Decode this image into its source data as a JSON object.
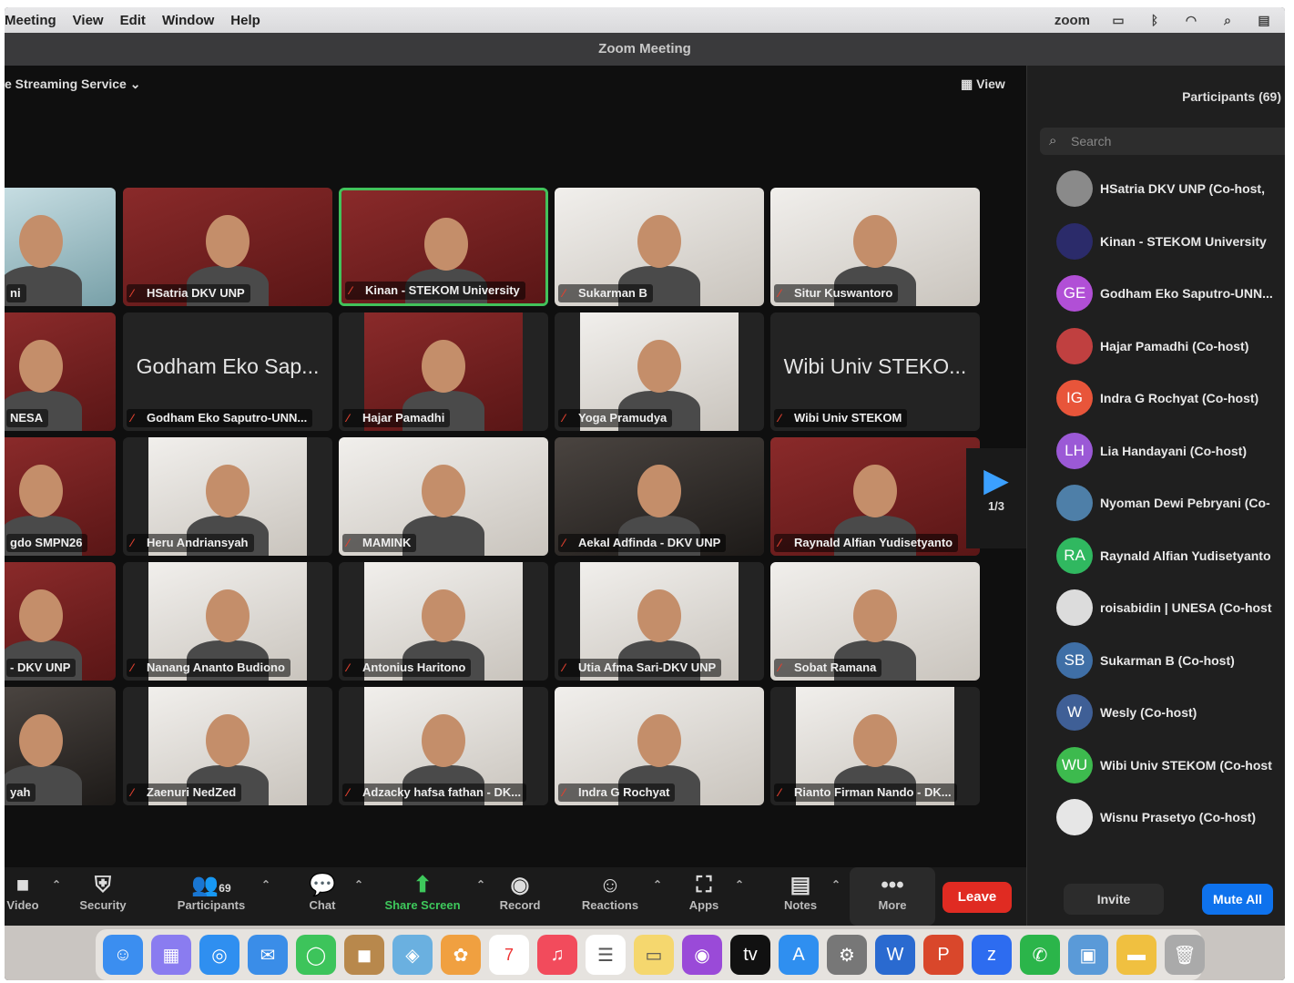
{
  "menubar": {
    "items": [
      "Meeting",
      "View",
      "Edit",
      "Window",
      "Help"
    ],
    "app_label": "zoom"
  },
  "window": {
    "title": "Zoom Meeting",
    "stream_label": "e Streaming Service",
    "view_label": "View"
  },
  "tiles": [
    {
      "name": "ni",
      "big": ""
    },
    {
      "name": "HSatria DKV UNP",
      "big": ""
    },
    {
      "name": "Kinan - STEKOM University",
      "big": "",
      "speaking": true
    },
    {
      "name": "Sukarman B",
      "big": ""
    },
    {
      "name": "Situr Kuswantoro",
      "big": ""
    },
    {
      "name": "NESA",
      "big": ""
    },
    {
      "name": "Godham Eko Saputro-UNN...",
      "big": "Godham Eko Sap..."
    },
    {
      "name": "Hajar Pamadhi",
      "big": ""
    },
    {
      "name": "Yoga Pramudya",
      "big": ""
    },
    {
      "name": "Wibi Univ STEKOM",
      "big": "Wibi Univ STEKO..."
    },
    {
      "name": "gdo SMPN26",
      "big": ""
    },
    {
      "name": "Heru Andriansyah",
      "big": ""
    },
    {
      "name": "MAMINK",
      "big": ""
    },
    {
      "name": "Aekal Adfinda - DKV UNP",
      "big": ""
    },
    {
      "name": "Raynald Alfian Yudisetyanto",
      "big": ""
    },
    {
      "name": "- DKV UNP",
      "big": ""
    },
    {
      "name": "Nanang Ananto Budiono",
      "big": ""
    },
    {
      "name": "Antonius Haritono",
      "big": ""
    },
    {
      "name": "Utia Afma Sari-DKV UNP",
      "big": ""
    },
    {
      "name": "Sobat Ramana",
      "big": ""
    },
    {
      "name": "yah",
      "big": ""
    },
    {
      "name": "Zaenuri NedZed",
      "big": ""
    },
    {
      "name": "Adzacky hafsa fathan - DK...",
      "big": ""
    },
    {
      "name": "Indra G Rochyat",
      "big": ""
    },
    {
      "name": "Rianto Firman Nando - DK...",
      "big": ""
    }
  ],
  "pager": {
    "label": "1/3"
  },
  "participants": {
    "title": "Participants (69)",
    "search_placeholder": "Search",
    "list": [
      {
        "name": "HSatria DKV UNP (Co-host,",
        "initials": "",
        "color": "#8a8a8a"
      },
      {
        "name": "Kinan - STEKOM University",
        "initials": "",
        "color": "#2b2b6a"
      },
      {
        "name": "Godham Eko Saputro-UNN...",
        "initials": "GE",
        "color": "#b14fd6"
      },
      {
        "name": "Hajar Pamadhi (Co-host)",
        "initials": "",
        "color": "#c04040"
      },
      {
        "name": "Indra G Rochyat (Co-host)",
        "initials": "IG",
        "color": "#e8553a"
      },
      {
        "name": "Lia Handayani (Co-host)",
        "initials": "LH",
        "color": "#9b59d6"
      },
      {
        "name": "Nyoman Dewi Pebryani (Co-",
        "initials": "",
        "color": "#4e7fa8"
      },
      {
        "name": "Raynald Alfian Yudisetyanto",
        "initials": "RA",
        "color": "#30b860"
      },
      {
        "name": "roisabidin | UNESA (Co-host",
        "initials": "",
        "color": "#dcdcdc"
      },
      {
        "name": "Sukarman B (Co-host)",
        "initials": "SB",
        "color": "#3f6fa6"
      },
      {
        "name": "Wesly (Co-host)",
        "initials": "W",
        "color": "#3f5f96"
      },
      {
        "name": "Wibi Univ STEKOM (Co-host",
        "initials": "WU",
        "color": "#3dba4e"
      },
      {
        "name": "Wisnu Prasetyo (Co-host)",
        "initials": "",
        "color": "#e6e6e6"
      }
    ],
    "invite_label": "Invite",
    "mute_all_label": "Mute All"
  },
  "toolbar": {
    "video": "Video",
    "security": "Security",
    "participants": "Participants",
    "participants_count": "69",
    "chat": "Chat",
    "share": "Share Screen",
    "record": "Record",
    "reactions": "Reactions",
    "apps": "Apps",
    "notes": "Notes",
    "more": "More",
    "leave": "Leave"
  },
  "dock": {
    "calendar_day": "7"
  }
}
